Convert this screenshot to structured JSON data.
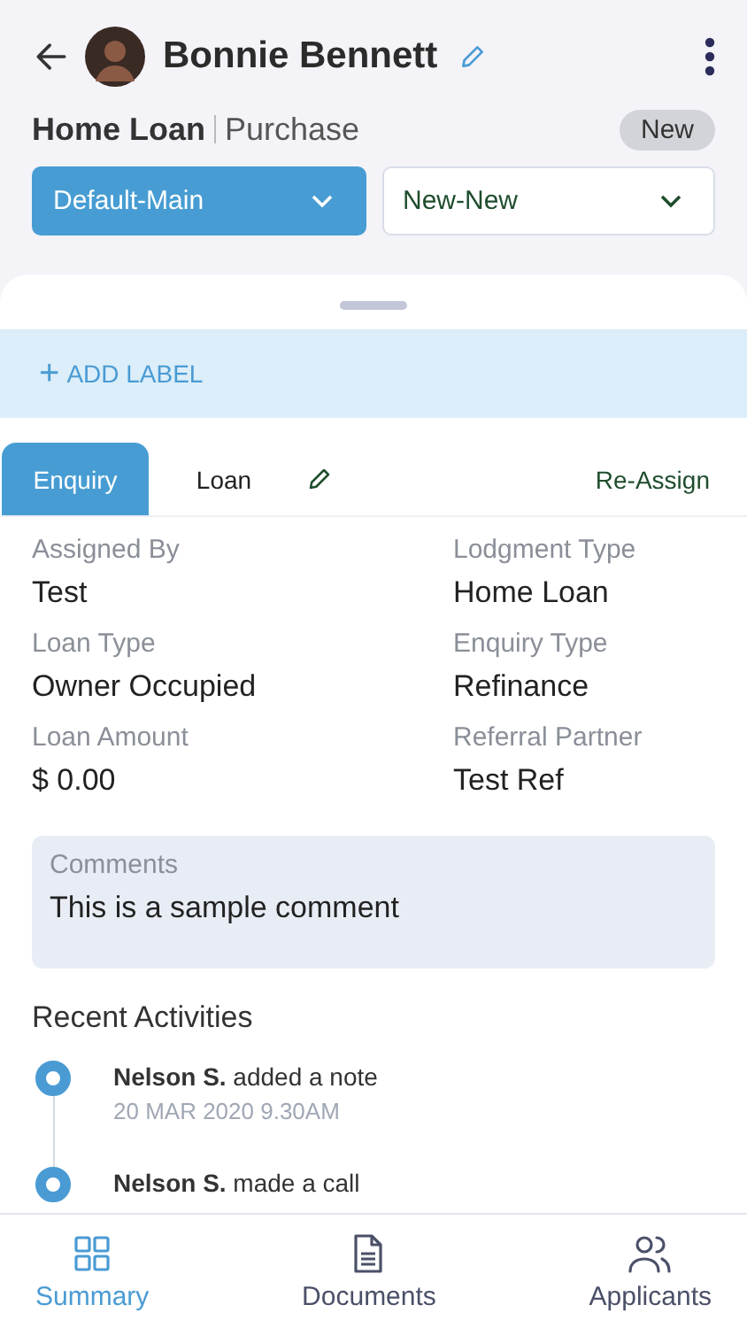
{
  "header": {
    "name": "Bonnie Bennett",
    "loan_type": "Home Loan",
    "loan_purpose": "Purchase",
    "status_badge": "New"
  },
  "dropdowns": [
    {
      "value": "Default-Main",
      "selected": true
    },
    {
      "value": "New-New",
      "selected": false
    }
  ],
  "add_label": {
    "icon": "+",
    "label": "ADD LABEL"
  },
  "tabs": [
    {
      "label": "Enquiry",
      "selected": true
    },
    {
      "label": "Loan",
      "selected": false
    }
  ],
  "reassign": "Re-Assign",
  "fields": [
    {
      "label": "Assigned By",
      "value": "Test"
    },
    {
      "label": "Lodgment Type",
      "value": "Home Loan"
    },
    {
      "label": "Loan Type",
      "value": "Owner Occupied"
    },
    {
      "label": "Enquiry Type",
      "value": "Refinance"
    },
    {
      "label": "Loan Amount",
      "value": "$ 0.00"
    },
    {
      "label": "Referral Partner",
      "value": "Test Ref"
    }
  ],
  "comments": {
    "label": "Comments",
    "text": "This is a sample comment"
  },
  "recent_activities": {
    "title": "Recent Activities",
    "items": [
      {
        "text": "**Nelson S.** added a note",
        "time": "20 MAR 2020  9.30AM"
      },
      {
        "text": "**Nelson S.** made a call"
      }
    ]
  },
  "bottom_nav": [
    {
      "kind": "grid",
      "label": "Summary",
      "selected": true
    },
    {
      "kind": "document",
      "label": "Documents",
      "selected": false
    },
    {
      "kind": "people",
      "label": "Applicants",
      "selected": false
    }
  ]
}
